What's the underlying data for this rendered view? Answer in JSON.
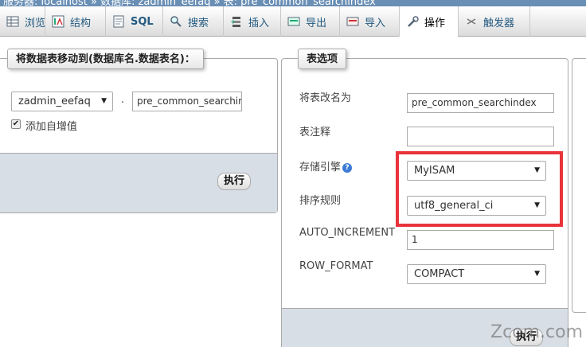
{
  "breadcrumb": {
    "text": "服务器: localhost » 数据库: zadmin_eefaq » 表: pre_common_searchindex"
  },
  "tabs": [
    {
      "label": "浏览",
      "icon": "browse-icon"
    },
    {
      "label": "结构",
      "icon": "structure-icon"
    },
    {
      "label": "SQL",
      "icon": "sql-icon"
    },
    {
      "label": "搜索",
      "icon": "search-icon"
    },
    {
      "label": "插入",
      "icon": "insert-icon"
    },
    {
      "label": "导出",
      "icon": "export-icon"
    },
    {
      "label": "导入",
      "icon": "import-icon"
    },
    {
      "label": "操作",
      "icon": "wrench-icon"
    },
    {
      "label": "触发器",
      "icon": "trigger-icon"
    }
  ],
  "move_panel": {
    "legend": "将数据表移动到(数据库名.数据表名)：",
    "database_select": "zadmin_eefaq",
    "dot": ".",
    "table_name_value": "pre_common_searchir",
    "auto_increment_label": "添加自增值",
    "auto_increment_checked": "✔",
    "submit_label": "执行"
  },
  "options_panel": {
    "legend": "表选项",
    "rename_label": "将表改名为",
    "rename_value": "pre_common_searchindex",
    "comment_label": "表注释",
    "comment_value": "",
    "engine_label": "存储引擎",
    "engine_value": "MyISAM",
    "collation_label": "排序规则",
    "collation_value": "utf8_general_ci",
    "auto_increment_label": "AUTO_INCREMENT",
    "auto_increment_value": "1",
    "row_format_label": "ROW_FORMAT",
    "row_format_value": "COMPACT",
    "submit_label": "执行"
  },
  "watermark": "Zcom.com",
  "colors": {
    "highlight": "#e8333a",
    "link": "#235a81",
    "footer": "#d8dee6"
  }
}
